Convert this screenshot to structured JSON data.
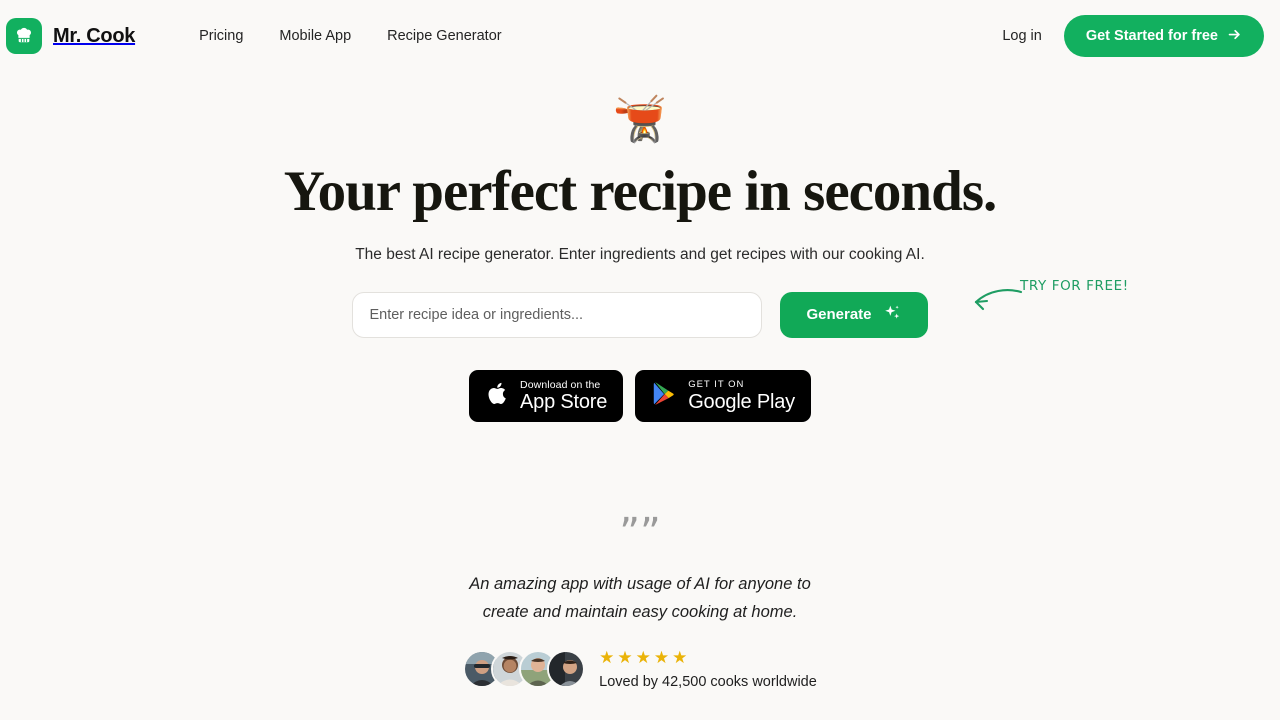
{
  "theme": {
    "background": "#faf9f7",
    "brand_green": "#12b05f",
    "button_green": "#11a957",
    "annotation_green": "#1f9d63",
    "star_gold": "#eab308",
    "badge_black": "#000000"
  },
  "header": {
    "logo_icon": "chef-hat-icon",
    "brand_name": "Mr. Cook",
    "nav": [
      {
        "label": "Pricing"
      },
      {
        "label": "Mobile App"
      },
      {
        "label": "Recipe Generator"
      }
    ],
    "login_label": "Log in",
    "cta_label": "Get Started for free",
    "cta_icon": "arrow-right-icon"
  },
  "hero": {
    "emoji": "🫕",
    "emoji_name": "fondue-pot-emoji",
    "title": "Your perfect recipe in seconds.",
    "subtitle": "The best AI recipe generator. Enter ingredients and get recipes with our cooking AI.",
    "search": {
      "value": "",
      "placeholder": "Enter recipe idea or ingredients...",
      "button_label": "Generate",
      "button_icon": "sparkle-icon"
    },
    "annotation": {
      "text": "TRY FOR FREE!",
      "arrow_icon": "curved-arrow-left-icon"
    }
  },
  "stores": [
    {
      "icon": "apple-logo-icon",
      "small_text": "Download on the",
      "big_text": "App Store"
    },
    {
      "icon": "google-play-icon",
      "small_text": "GET IT ON",
      "big_text": "Google Play"
    }
  ],
  "testimonial": {
    "quote_mark": "”",
    "quote_line_1": "An amazing app with usage of AI for anyone to",
    "quote_line_2": "create and maintain easy cooking at home.",
    "avatars": [
      {
        "name": "avatar-1"
      },
      {
        "name": "avatar-2"
      },
      {
        "name": "avatar-3"
      },
      {
        "name": "avatar-4"
      }
    ],
    "stars": "★★★★★",
    "star_count": 5,
    "proof_text": "Loved by 42,500 cooks worldwide"
  }
}
